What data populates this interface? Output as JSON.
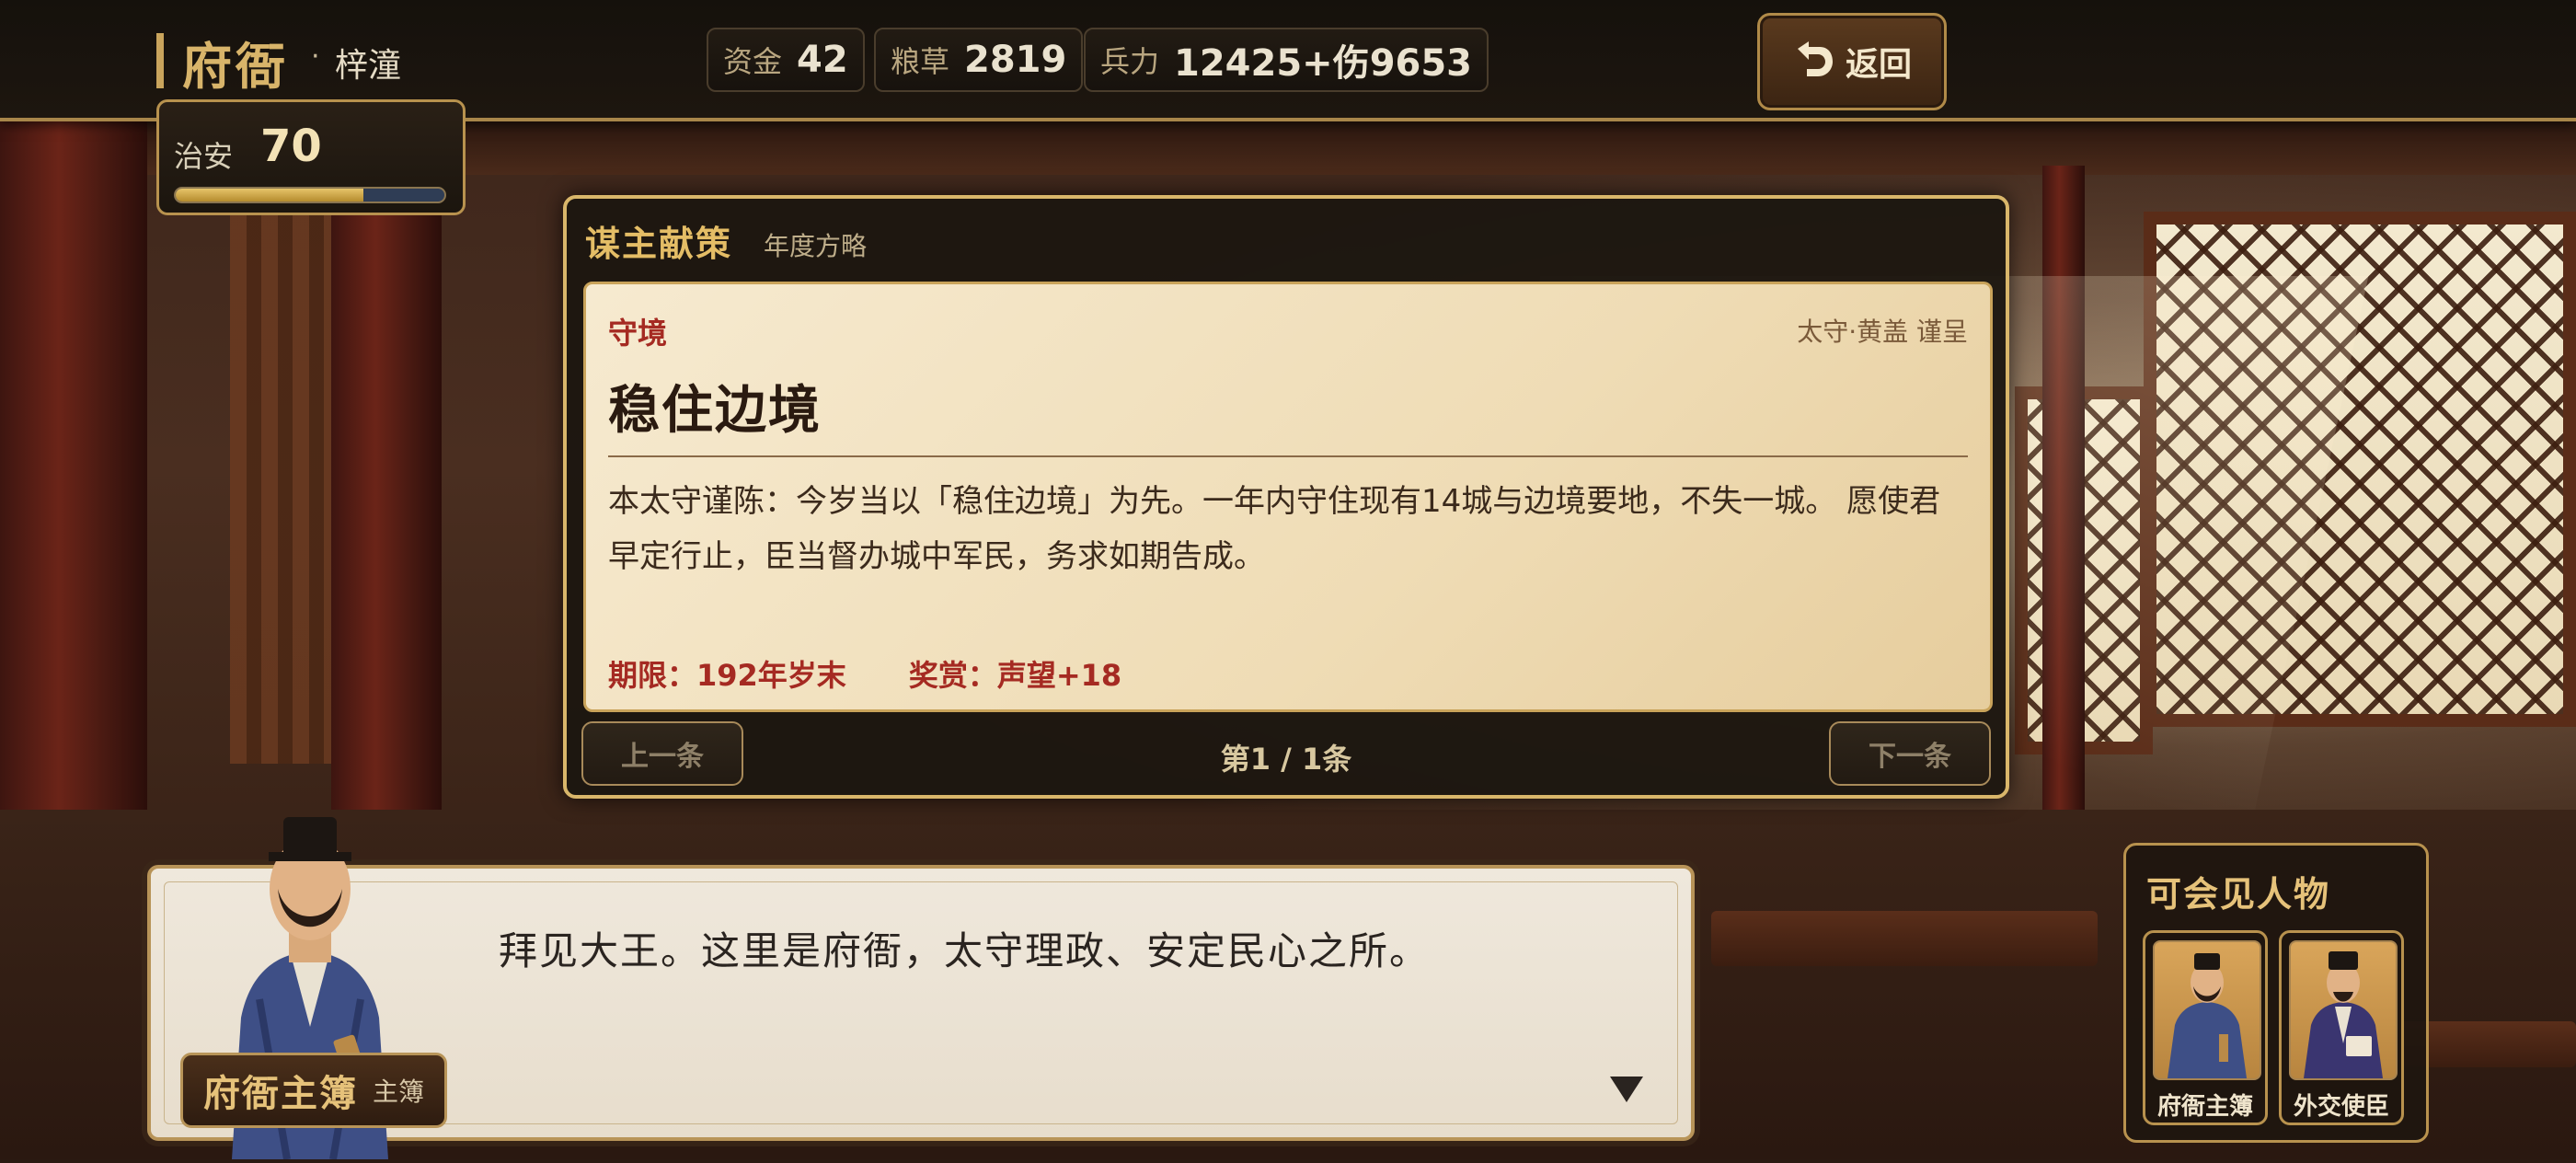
{
  "location": {
    "title": "府衙",
    "separator": "·",
    "city": "梓潼"
  },
  "resources": [
    {
      "label": "资金",
      "value": "42"
    },
    {
      "label": "粮草",
      "value": "2819"
    },
    {
      "label": "兵力",
      "value": "12425+伤9653"
    }
  ],
  "back_button": {
    "label": "返回",
    "icon": "return-arrow-icon"
  },
  "public_order": {
    "label": "治安",
    "value": "70",
    "fill_fraction": 0.7,
    "fill_color": "#d6b04e"
  },
  "strategy": {
    "title": "谋主献策",
    "subtitle": "年度方略",
    "card": {
      "tag": "守境",
      "signature": "太守·黄盖 谨呈",
      "heading": "稳住边境",
      "body": "本太守谨陈：今岁当以「稳住边境」为先。一年内守住现有14城与边境要地，不失一城。 愿使君早定行止，臣当督办城中军民，务求如期告成。",
      "deadline": "期限：192年岁末",
      "reward": "奖赏：声望+18"
    },
    "prev_label": "上一条",
    "next_label": "下一条",
    "page_info": "第1 / 1条"
  },
  "dialogue": {
    "text": "拜见大王。这里是府衙，太守理政、安定民心之所。",
    "speaker_name": "府衙主簿",
    "speaker_role": "主簿"
  },
  "visitable": {
    "title": "可会见人物",
    "characters": [
      {
        "name": "府衙主簿",
        "robe_color": "#3e4f86"
      },
      {
        "name": "外交使臣",
        "robe_color": "#3a3570"
      }
    ]
  },
  "colors": {
    "accent_gold": "#d9b66a",
    "red_text": "#a52a22"
  }
}
